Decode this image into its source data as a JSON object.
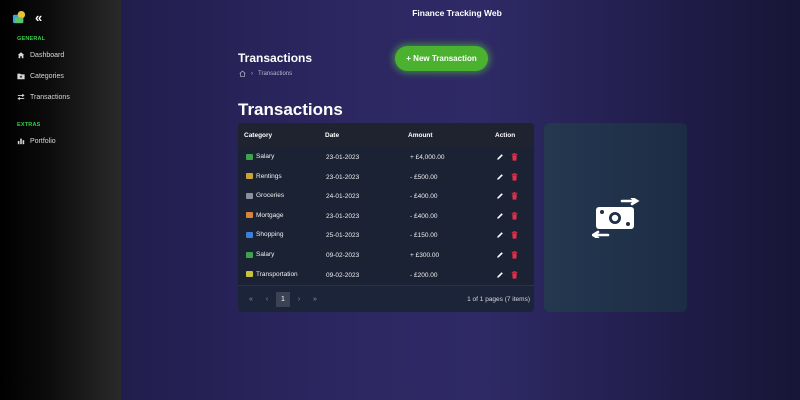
{
  "app": {
    "title": "Finance Tracking Web"
  },
  "sidebar": {
    "collapse_glyph": "«",
    "sections": [
      {
        "label": "GENERAL",
        "items": [
          {
            "label": "Dashboard",
            "icon": "home-icon"
          },
          {
            "label": "Categories",
            "icon": "folder-plus-icon"
          },
          {
            "label": "Transactions",
            "icon": "arrows-exchange-icon"
          }
        ]
      },
      {
        "label": "EXTRAS",
        "items": [
          {
            "label": "Portfolio",
            "icon": "bar-chart-icon"
          }
        ]
      }
    ]
  },
  "page": {
    "heading": "Transactions",
    "breadcrumb": "Transactions",
    "new_button": "+ New Transaction",
    "section_title": "Transactions"
  },
  "table": {
    "headers": {
      "category": "Category",
      "date": "Date",
      "amount": "Amount",
      "action": "Action"
    },
    "rows": [
      {
        "category": "Salary",
        "icon": "money-icon",
        "icon_color": "#3fa34d",
        "date": "23-01-2023",
        "amount": "+ £4,000.00"
      },
      {
        "category": "Rentings",
        "icon": "money-bag-icon",
        "icon_color": "#c9a43a",
        "date": "23-01-2023",
        "amount": "- £500.00"
      },
      {
        "category": "Groceries",
        "icon": "receipt-icon",
        "icon_color": "#8a8f99",
        "date": "24-01-2023",
        "amount": "- £400.00"
      },
      {
        "category": "Mortgage",
        "icon": "house-icon",
        "icon_color": "#d9823b",
        "date": "23-01-2023",
        "amount": "- £400.00"
      },
      {
        "category": "Shopping",
        "icon": "shopping-bags-icon",
        "icon_color": "#3b7fd9",
        "date": "25-01-2023",
        "amount": "- £150.00"
      },
      {
        "category": "Salary",
        "icon": "money-icon",
        "icon_color": "#3fa34d",
        "date": "09-02-2023",
        "amount": "+ £300.00"
      },
      {
        "category": "Transportation",
        "icon": "ticket-icon",
        "icon_color": "#c6c43c",
        "date": "09-02-2023",
        "amount": "- £200.00"
      }
    ],
    "pagination": {
      "first": "«",
      "prev": "‹",
      "current": "1",
      "next": "›",
      "last": "»",
      "info": "1 of 1 pages (7 items)"
    }
  },
  "colors": {
    "accent_green": "#4ab22f",
    "section_green": "#35d14a",
    "delete_red": "#e0304a"
  }
}
